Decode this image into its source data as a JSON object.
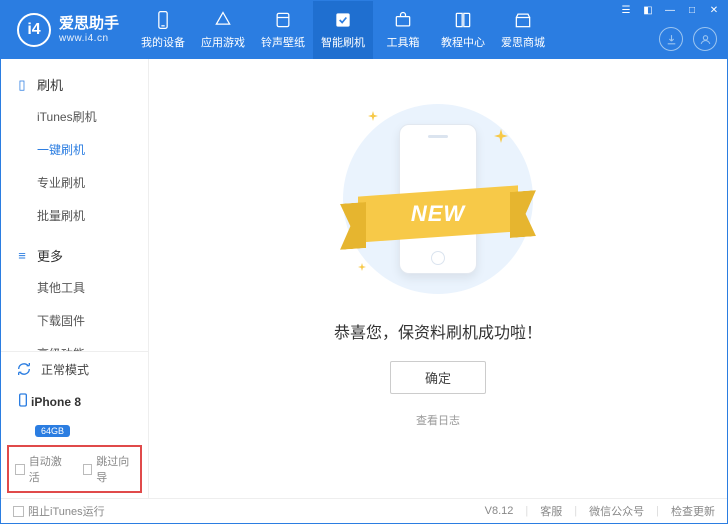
{
  "app": {
    "logo_mark": "i4",
    "name_cn": "爱思助手",
    "url": "www.i4.cn"
  },
  "nav": [
    {
      "key": "device",
      "label": "我的设备"
    },
    {
      "key": "apps",
      "label": "应用游戏"
    },
    {
      "key": "ring",
      "label": "铃声壁纸"
    },
    {
      "key": "flash",
      "label": "智能刷机",
      "active": true
    },
    {
      "key": "tools",
      "label": "工具箱"
    },
    {
      "key": "tutorial",
      "label": "教程中心"
    },
    {
      "key": "store",
      "label": "爱思商城"
    }
  ],
  "sidebar": {
    "groups": [
      {
        "title": "刷机",
        "items": [
          "iTunes刷机",
          "一键刷机",
          "专业刷机",
          "批量刷机"
        ],
        "selected": 1
      },
      {
        "title": "更多",
        "items": [
          "其他工具",
          "下载固件",
          "高级功能"
        ],
        "selected": -1
      }
    ],
    "mode_label": "正常模式",
    "device_name": "iPhone 8",
    "device_storage": "64GB",
    "checkboxes": {
      "auto_activate": "自动激活",
      "skip_guide": "跳过向导"
    }
  },
  "main": {
    "ribbon": "NEW",
    "success_text": "恭喜您，保资料刷机成功啦！",
    "confirm_label": "确定",
    "view_log": "查看日志"
  },
  "footer": {
    "block_itunes": "阻止iTunes运行",
    "version": "V8.12",
    "support": "客服",
    "wechat": "微信公众号",
    "update": "检查更新"
  }
}
